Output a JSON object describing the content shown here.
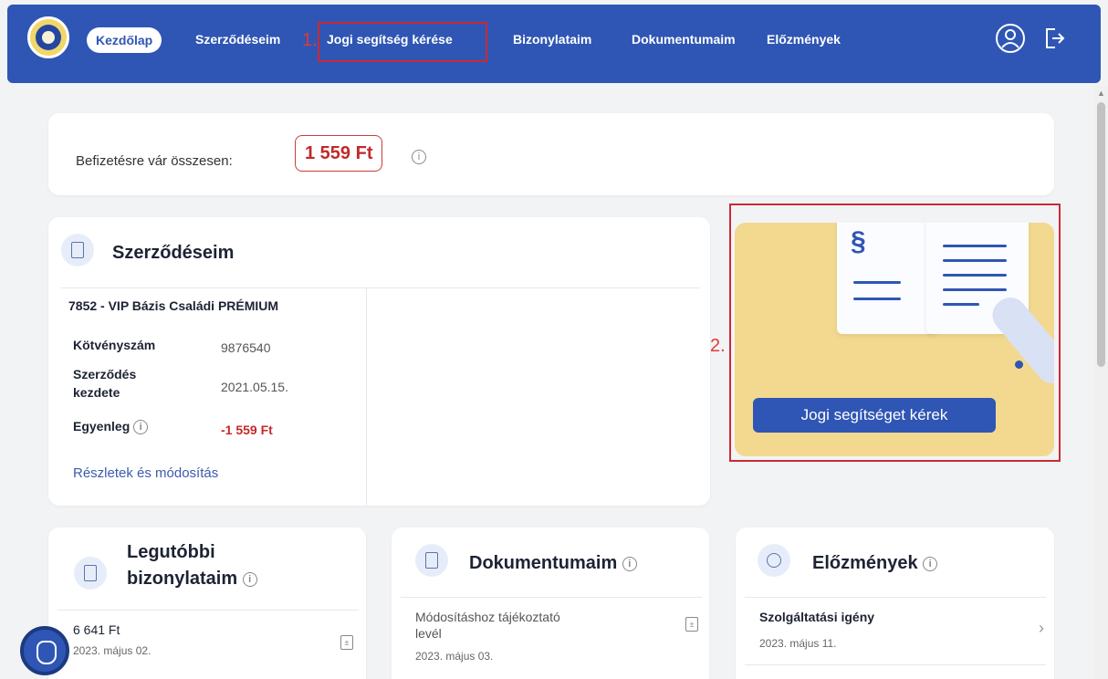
{
  "nav": {
    "home": "Kezdőlap",
    "contracts": "Szerződéseim",
    "legal_help": "Jogi segítség kérése",
    "receipts": "Bizonylataim",
    "documents": "Dokumentumaim",
    "history": "Előzmények",
    "profile_icon": "user-circle-icon",
    "logout_icon": "logout-icon"
  },
  "markers": {
    "m1": "1.",
    "m2": "2."
  },
  "summary": {
    "label": "Befizetésre vár összesen:",
    "amount": "1 559 Ft",
    "info": "i"
  },
  "contracts": {
    "title": "Szerződéseim",
    "product": "7852 - VIP Bázis Családi PRÉMIUM",
    "policy_label": "Kötvényszám",
    "policy_value": "9876540",
    "start_label_1": "Szerződés",
    "start_label_2": "kezdete",
    "start_value": "2021.05.15.",
    "balance_label": "Egyenleg",
    "balance_value": "-1 559 Ft",
    "details_link": "Részletek és módosítás"
  },
  "promo": {
    "button": "Jogi segítséget kérek",
    "paragraph_sign": "§"
  },
  "receipts": {
    "title_1": "Legutóbbi",
    "title_2": "bizonylataim",
    "items": [
      {
        "amount": "6 641 Ft",
        "date": "2023. május 02."
      }
    ]
  },
  "documents": {
    "title": "Dokumentumaim",
    "items": [
      {
        "name_1": "Módosításhoz tájékoztató",
        "name_2": "levél",
        "date": "2023. május 03."
      }
    ]
  },
  "history": {
    "title": "Előzmények",
    "items": [
      {
        "name": "Szolgáltatási igény",
        "date": "2023. május 11."
      }
    ]
  },
  "colors": {
    "brand": "#2f56b4",
    "negative": "#c62828",
    "promo_bg": "#f3d98f",
    "highlight": "#c92a37"
  }
}
